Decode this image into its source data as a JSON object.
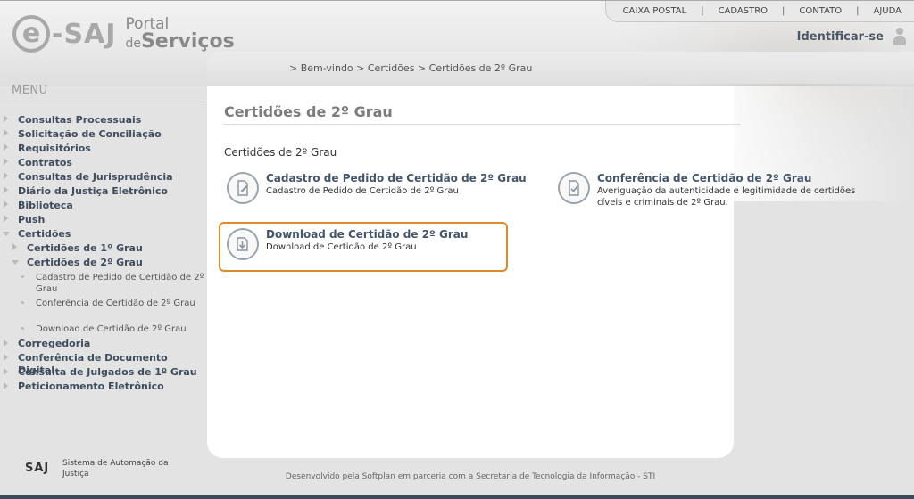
{
  "header": {
    "logo_e": "e",
    "logo_saj": "-SAJ",
    "logo_portal_line1": "Portal",
    "logo_portal_de": "de",
    "logo_portal_servicos": "Serviços",
    "top_links": [
      "CAIXA POSTAL",
      "CADASTRO",
      "CONTATO",
      "AJUDA"
    ],
    "separator": "|",
    "identify_label": "Identificar-se",
    "identify_icon": "person-icon"
  },
  "breadcrumb": {
    "text": "> Bem-vindo > Certidões > Certidões de 2º Grau"
  },
  "sidebar": {
    "title": "MENU",
    "items": [
      {
        "label": "Consultas Processuais"
      },
      {
        "label": "Solicitação de Conciliação"
      },
      {
        "label": "Requisitórios"
      },
      {
        "label": "Contratos"
      },
      {
        "label": "Consultas de Jurisprudência"
      },
      {
        "label": "Diário da Justiça Eletrônico"
      },
      {
        "label": "Biblioteca"
      },
      {
        "label": "Push"
      },
      {
        "label": "Certidões"
      },
      {
        "label": "Certidões de 1º Grau"
      },
      {
        "label": "Certidões de 2º Grau"
      },
      {
        "label": "Cadastro de Pedido de Certidão de 2º Grau"
      },
      {
        "label": "Conferência de Certidão de 2º Grau"
      },
      {
        "label": "Download de Certidão de 2º Grau"
      },
      {
        "label": "Corregedoria"
      },
      {
        "label": "Conferência de Documento Digital"
      },
      {
        "label": "Consulta de Julgados de 1º Grau"
      },
      {
        "label": "Peticionamento Eletrônico"
      }
    ]
  },
  "main": {
    "page_title": "Certidões de 2º Grau",
    "section_title": "Certidões de 2º Grau",
    "cards": [
      {
        "title": "Cadastro de Pedido de Certidão de 2º Grau",
        "desc": "Cadastro de Pedido de Certidão de 2º Grau",
        "icon": "document-pen-icon"
      },
      {
        "title": "Conferência de Certidão de 2º Grau",
        "desc": "Averiguação da autenticidade e legitimidade de certidões cíveis e criminais de 2º Grau.",
        "icon": "document-check-icon"
      },
      {
        "title": "Download de Certidão de 2º Grau",
        "desc": "Download de Certidão de 2º Grau",
        "icon": "download-icon"
      }
    ]
  },
  "footer": {
    "logo": "SAJ",
    "system_name": "Sistema de Automação da Justiça",
    "developed_by": "Desenvolvido pela Softplan em parceria com a Secretaria de Tecnologia da Informação - STI"
  },
  "colors": {
    "accent_highlight": "#e08a2c",
    "link_blue": "#45556a"
  }
}
